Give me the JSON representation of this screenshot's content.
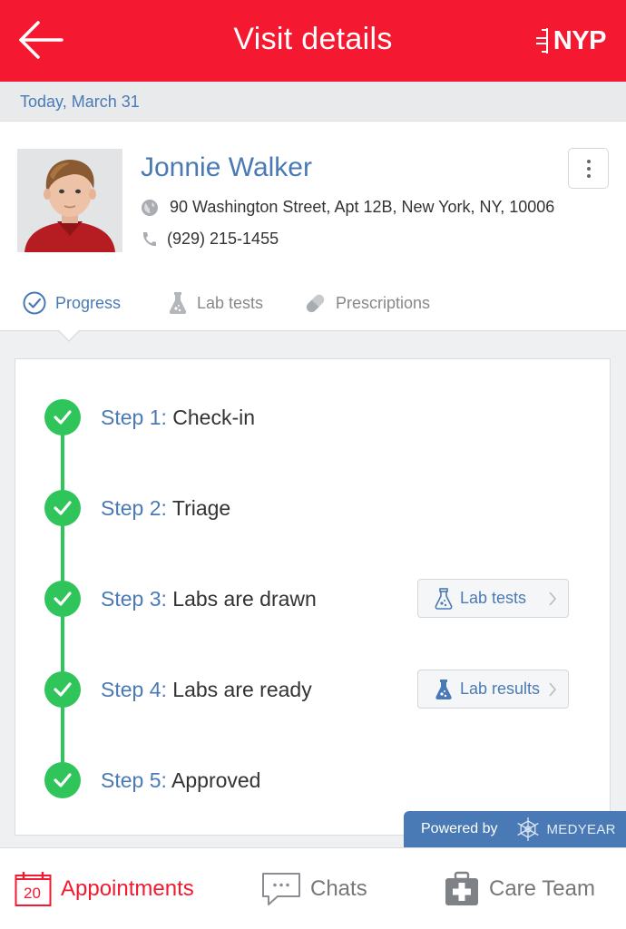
{
  "header": {
    "title": "Visit details",
    "brand": "NYP"
  },
  "date_bar": {
    "text": "Today, March 31"
  },
  "patient": {
    "name": "Jonnie Walker",
    "address": "90 Washington Street, Apt 12B, New York, NY, 10006",
    "phone": "(929) 215-1455"
  },
  "tabs": [
    {
      "label": "Progress",
      "icon": "check-circle-icon",
      "active": true
    },
    {
      "label": "Lab tests",
      "icon": "flask-icon",
      "active": false
    },
    {
      "label": "Prescriptions",
      "icon": "pill-icon",
      "active": false
    }
  ],
  "steps": [
    {
      "prefix": "Step 1:",
      "label": "Check-in",
      "done": true
    },
    {
      "prefix": "Step 2:",
      "label": "Triage",
      "done": true
    },
    {
      "prefix": "Step 3:",
      "label": "Labs are drawn",
      "done": true,
      "action": "Lab tests"
    },
    {
      "prefix": "Step 4:",
      "label": "Labs are ready",
      "done": true,
      "action": "Lab results"
    },
    {
      "prefix": "Step 5:",
      "label": "Approved",
      "done": true
    }
  ],
  "powered_by": {
    "text": "Powered by",
    "brand": "MEDYEAR"
  },
  "bottom_nav": {
    "items": [
      {
        "label": "Appointments",
        "icon": "calendar-icon",
        "badge": "20",
        "active": true
      },
      {
        "label": "Chats",
        "icon": "chat-bubble-icon",
        "active": false
      },
      {
        "label": "Care Team",
        "icon": "medical-kit-icon",
        "active": false
      }
    ]
  },
  "colors": {
    "header_red": "#f41930",
    "accent_blue": "#4a7ab5",
    "success_green": "#2fc55b"
  }
}
